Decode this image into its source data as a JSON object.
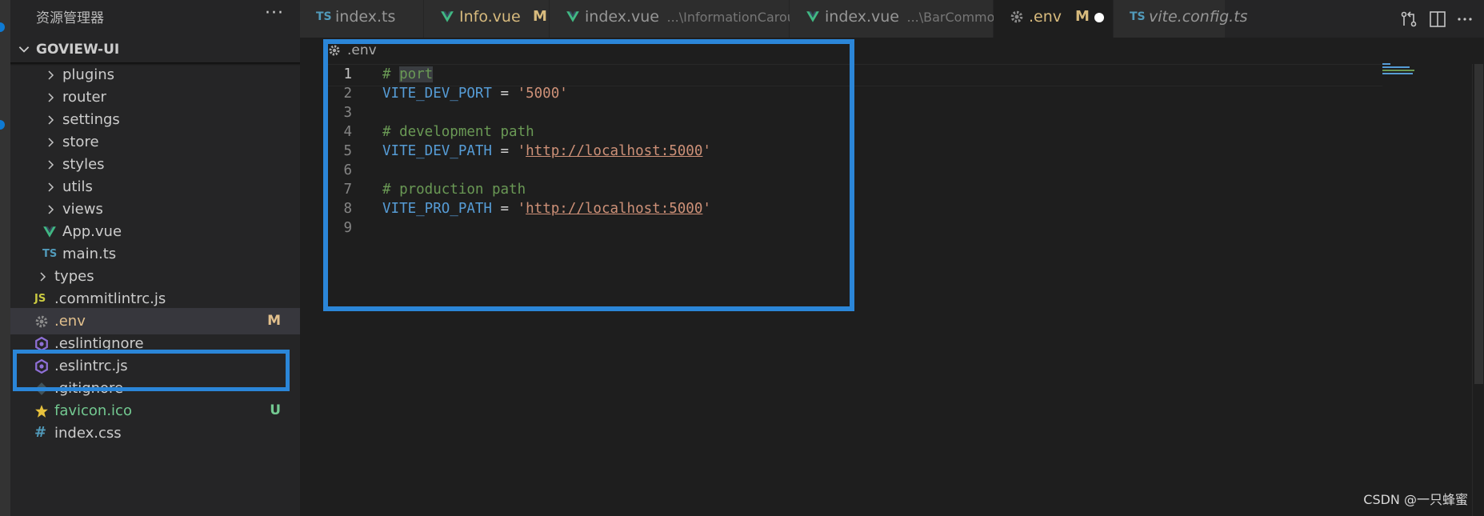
{
  "explorer": {
    "title": "资源管理器",
    "more": "···",
    "root": "GOVIEW-UI",
    "items": [
      {
        "kind": "folder",
        "label": "plugins",
        "icon": "chevron-right-icon"
      },
      {
        "kind": "folder",
        "label": "router",
        "icon": "chevron-right-icon"
      },
      {
        "kind": "folder",
        "label": "settings",
        "icon": "chevron-right-icon"
      },
      {
        "kind": "folder",
        "label": "store",
        "icon": "chevron-right-icon"
      },
      {
        "kind": "folder",
        "label": "styles",
        "icon": "chevron-right-icon"
      },
      {
        "kind": "folder",
        "label": "utils",
        "icon": "chevron-right-icon"
      },
      {
        "kind": "folder",
        "label": "views",
        "icon": "chevron-right-icon"
      },
      {
        "kind": "file",
        "label": "App.vue",
        "icon": "vue-icon"
      },
      {
        "kind": "file",
        "label": "main.ts",
        "icon": "typescript-icon",
        "icon_text": "TS"
      },
      {
        "kind": "folder",
        "label": "types",
        "icon": "chevron-right-icon"
      },
      {
        "kind": "file",
        "label": ".commitlintrc.js",
        "icon": "javascript-icon",
        "icon_text": "JS"
      },
      {
        "kind": "file",
        "label": ".env",
        "icon": "gear-icon",
        "badge": "M",
        "selected": true
      },
      {
        "kind": "file",
        "label": ".eslintignore",
        "icon": "eslint-icon"
      },
      {
        "kind": "file",
        "label": ".eslintrc.js",
        "icon": "eslint-icon"
      },
      {
        "kind": "file",
        "label": ".gitignore",
        "icon": "git-icon"
      },
      {
        "kind": "file",
        "label": "favicon.ico",
        "icon": "star-icon",
        "badge": "U"
      },
      {
        "kind": "file",
        "label": "index.css",
        "icon": "hash-icon",
        "icon_text": "#"
      }
    ]
  },
  "tabs": [
    {
      "label": "index.ts",
      "icon": "typescript-icon",
      "icon_text": "TS",
      "description": "",
      "badge": ""
    },
    {
      "label": "Info.vue",
      "icon": "vue-icon",
      "description": "",
      "badge": "M"
    },
    {
      "label": "index.vue",
      "icon": "vue-icon",
      "description": "...\\InformationCarousel",
      "badge": ""
    },
    {
      "label": "index.vue",
      "icon": "vue-icon",
      "description": "...\\BarCommon",
      "badge": ""
    },
    {
      "label": ".env",
      "icon": "gear-icon",
      "description": "",
      "badge": "M",
      "active": true,
      "dirty": true
    },
    {
      "label": "vite.config.ts",
      "icon": "typescript-icon",
      "icon_text": "TS",
      "description": "",
      "badge": ""
    }
  ],
  "breadcrumb": {
    "label": ".env",
    "icon": "gear-icon"
  },
  "editor": {
    "current_line": 1,
    "lines": [
      {
        "n": "1",
        "tokens": [
          {
            "t": "comment",
            "v": "# "
          },
          {
            "t": "comment-hl",
            "v": "port"
          }
        ]
      },
      {
        "n": "2",
        "tokens": [
          {
            "t": "key",
            "v": "VITE_DEV_PORT"
          },
          {
            "t": "op",
            "v": " = "
          },
          {
            "t": "str",
            "v": "'5000'"
          }
        ]
      },
      {
        "n": "3",
        "tokens": []
      },
      {
        "n": "4",
        "tokens": [
          {
            "t": "comment",
            "v": "# development path"
          }
        ]
      },
      {
        "n": "5",
        "tokens": [
          {
            "t": "key",
            "v": "VITE_DEV_PATH"
          },
          {
            "t": "op",
            "v": " = "
          },
          {
            "t": "str",
            "v": "'"
          },
          {
            "t": "url",
            "v": "http://localhost:5000"
          },
          {
            "t": "str",
            "v": "'"
          }
        ]
      },
      {
        "n": "6",
        "tokens": []
      },
      {
        "n": "7",
        "tokens": [
          {
            "t": "comment",
            "v": "# production path"
          }
        ]
      },
      {
        "n": "8",
        "tokens": [
          {
            "t": "key",
            "v": "VITE_PRO_PATH"
          },
          {
            "t": "op",
            "v": " = "
          },
          {
            "t": "str",
            "v": "'"
          },
          {
            "t": "url",
            "v": "http://localhost:5000"
          },
          {
            "t": "str",
            "v": "'"
          }
        ]
      },
      {
        "n": "9",
        "tokens": []
      }
    ]
  },
  "watermark": "CSDN @一只蜂蜜",
  "colors": {
    "accent": "#2b86d8",
    "modified": "#e2c08d",
    "untracked": "#73c991",
    "vue": "#41b883",
    "typescript": "#519aba"
  }
}
